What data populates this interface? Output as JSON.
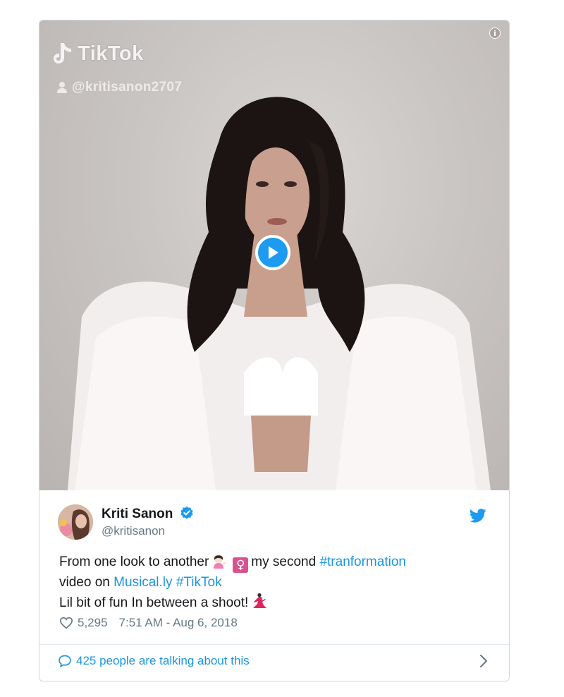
{
  "video": {
    "brand": "TikTok",
    "handle": "@kritisanon2707",
    "info_icon": "info-icon",
    "play_icon": "play-icon"
  },
  "tweet": {
    "author_name": "Kriti Sanon",
    "author_handle": "@kritisanon",
    "verified": true,
    "text": {
      "line1_prefix": "From one look to another",
      "line1_mid": "my second",
      "hashtag_transformation": "#tranformation",
      "line2_prefix": "video on",
      "link_musically": "Musical.ly",
      "hashtag_tiktok": "#TikTok",
      "line3": "Lil bit of fun In between a shoot!"
    },
    "likes": "5,295",
    "timestamp": "7:51 AM - Aug 6, 2018",
    "talking_label": "425 people are talking about this"
  },
  "colors": {
    "link": "#1b95e0",
    "muted": "#657786",
    "text": "#14171a",
    "twitter_blue": "#1d9bf0"
  }
}
